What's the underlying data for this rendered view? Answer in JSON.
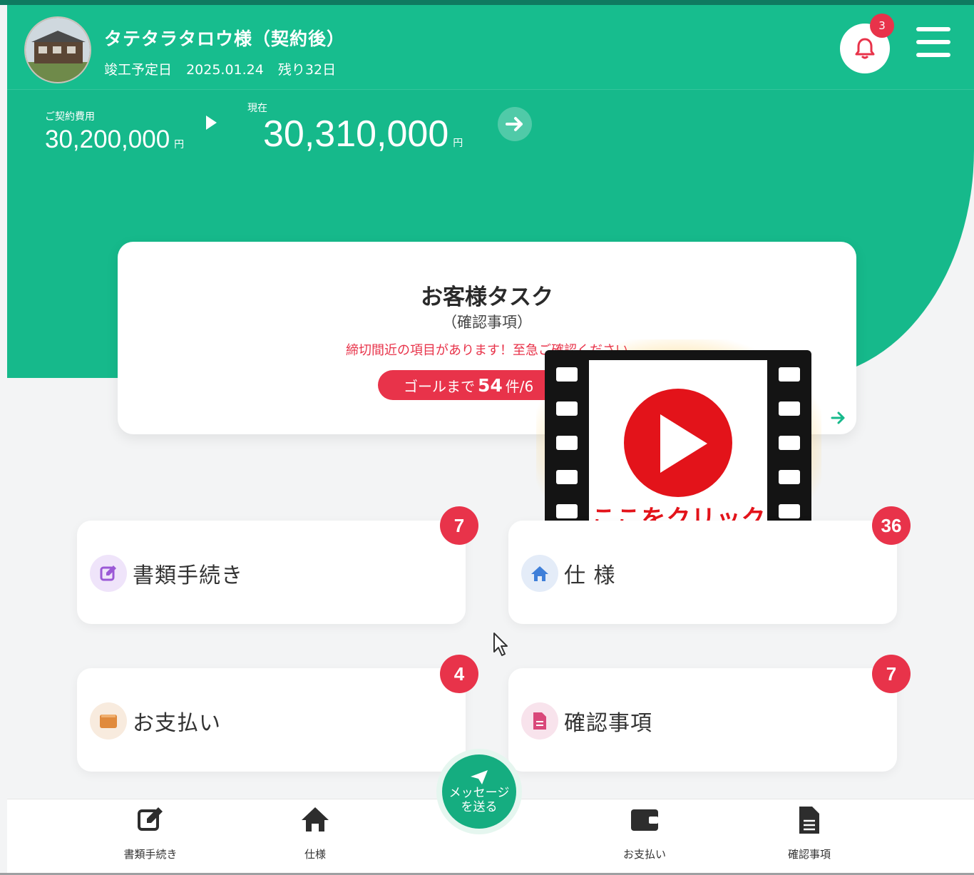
{
  "header": {
    "customer_name": "タテタラタロウ様（契約後）",
    "completion_label": "竣工予定日",
    "completion_date": "2025.01.24",
    "remaining": "残り32日",
    "notification_count": "3"
  },
  "costs": {
    "contract_label": "ご契約費用",
    "contract_value": "30,200,000",
    "current_label": "現在",
    "current_value": "30,310,000",
    "currency": "円"
  },
  "task_card": {
    "title": "お客様タスク",
    "subtitle": "（確認事項）",
    "warning": "締切間近の項目があります！至急ご確認ください",
    "goal_prefix": "ゴールまで",
    "goal_count": "54",
    "goal_suffix": "件/6"
  },
  "video": {
    "caption": "ここをクリック"
  },
  "menu": [
    {
      "label": "書類手続き",
      "badge": "7",
      "icon": "edit-icon",
      "color": "#9b59d6"
    },
    {
      "label": "仕 様",
      "badge": "36",
      "icon": "home-icon",
      "color": "#3f7fd9"
    },
    {
      "label": "お支払い",
      "badge": "4",
      "icon": "wallet-icon",
      "color": "#e08a3c"
    },
    {
      "label": "確認事項",
      "badge": "7",
      "icon": "document-icon",
      "color": "#d9487a"
    }
  ],
  "bottom_nav": {
    "items": [
      {
        "label": "書類手続き",
        "icon": "edit-icon"
      },
      {
        "label": "仕様",
        "icon": "home-icon"
      },
      {
        "label": "お支払い",
        "icon": "wallet-icon"
      },
      {
        "label": "確認事項",
        "icon": "document-icon"
      }
    ],
    "message_line1": "メッセージ",
    "message_line2": "を送る"
  },
  "colors": {
    "brand_green": "#16b98b",
    "alert_red": "#e8334a",
    "background": "#f3f4f5"
  }
}
